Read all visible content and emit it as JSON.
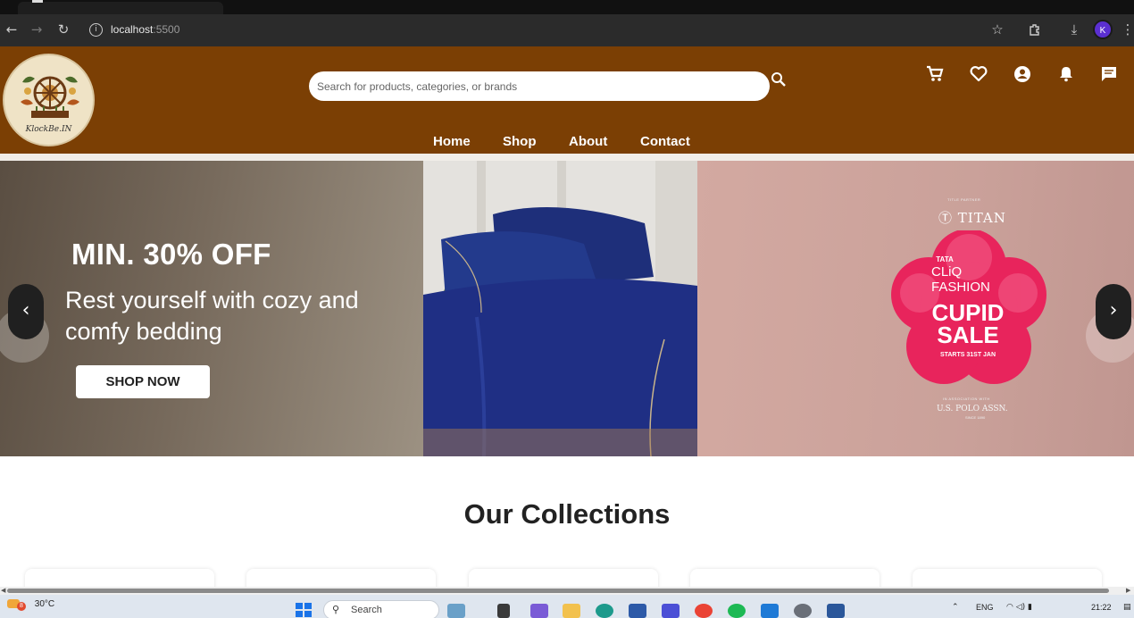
{
  "browser": {
    "url_host": "localhost",
    "url_port": ":5500",
    "profile_initial": "K"
  },
  "header": {
    "logo_text": "KlockBe.IN",
    "search_placeholder": "Search for products, categories, or brands",
    "nav": [
      "Home",
      "Shop",
      "About",
      "Contact"
    ]
  },
  "hero": {
    "title": "MIN. 30% OFF",
    "subtitle": "Rest yourself with cozy and comfy bedding",
    "cta": "SHOP NOW",
    "right_panel": {
      "tag_top": "TITLE PARTNER",
      "brand": "TITAN",
      "flower_line1": "TATA",
      "flower_line2": "CLiQ",
      "flower_line3": "FASHION",
      "sale_line1": "CUPID",
      "sale_line2": "SALE",
      "starts": "STARTS 31ST JAN",
      "association": "IN ASSOCIATION WITH",
      "polo": "U.S. POLO ASSN.",
      "polo_sub": "SINCE 1890"
    }
  },
  "collections": {
    "heading": "Our Collections"
  },
  "taskbar": {
    "weather_temp": "30°C",
    "weather_badge": "8",
    "search_label": "Search",
    "lang": "ENG",
    "time": "21:22"
  },
  "colors": {
    "header_brown": "#7b3f04",
    "flower_pink": "#e8245c"
  }
}
